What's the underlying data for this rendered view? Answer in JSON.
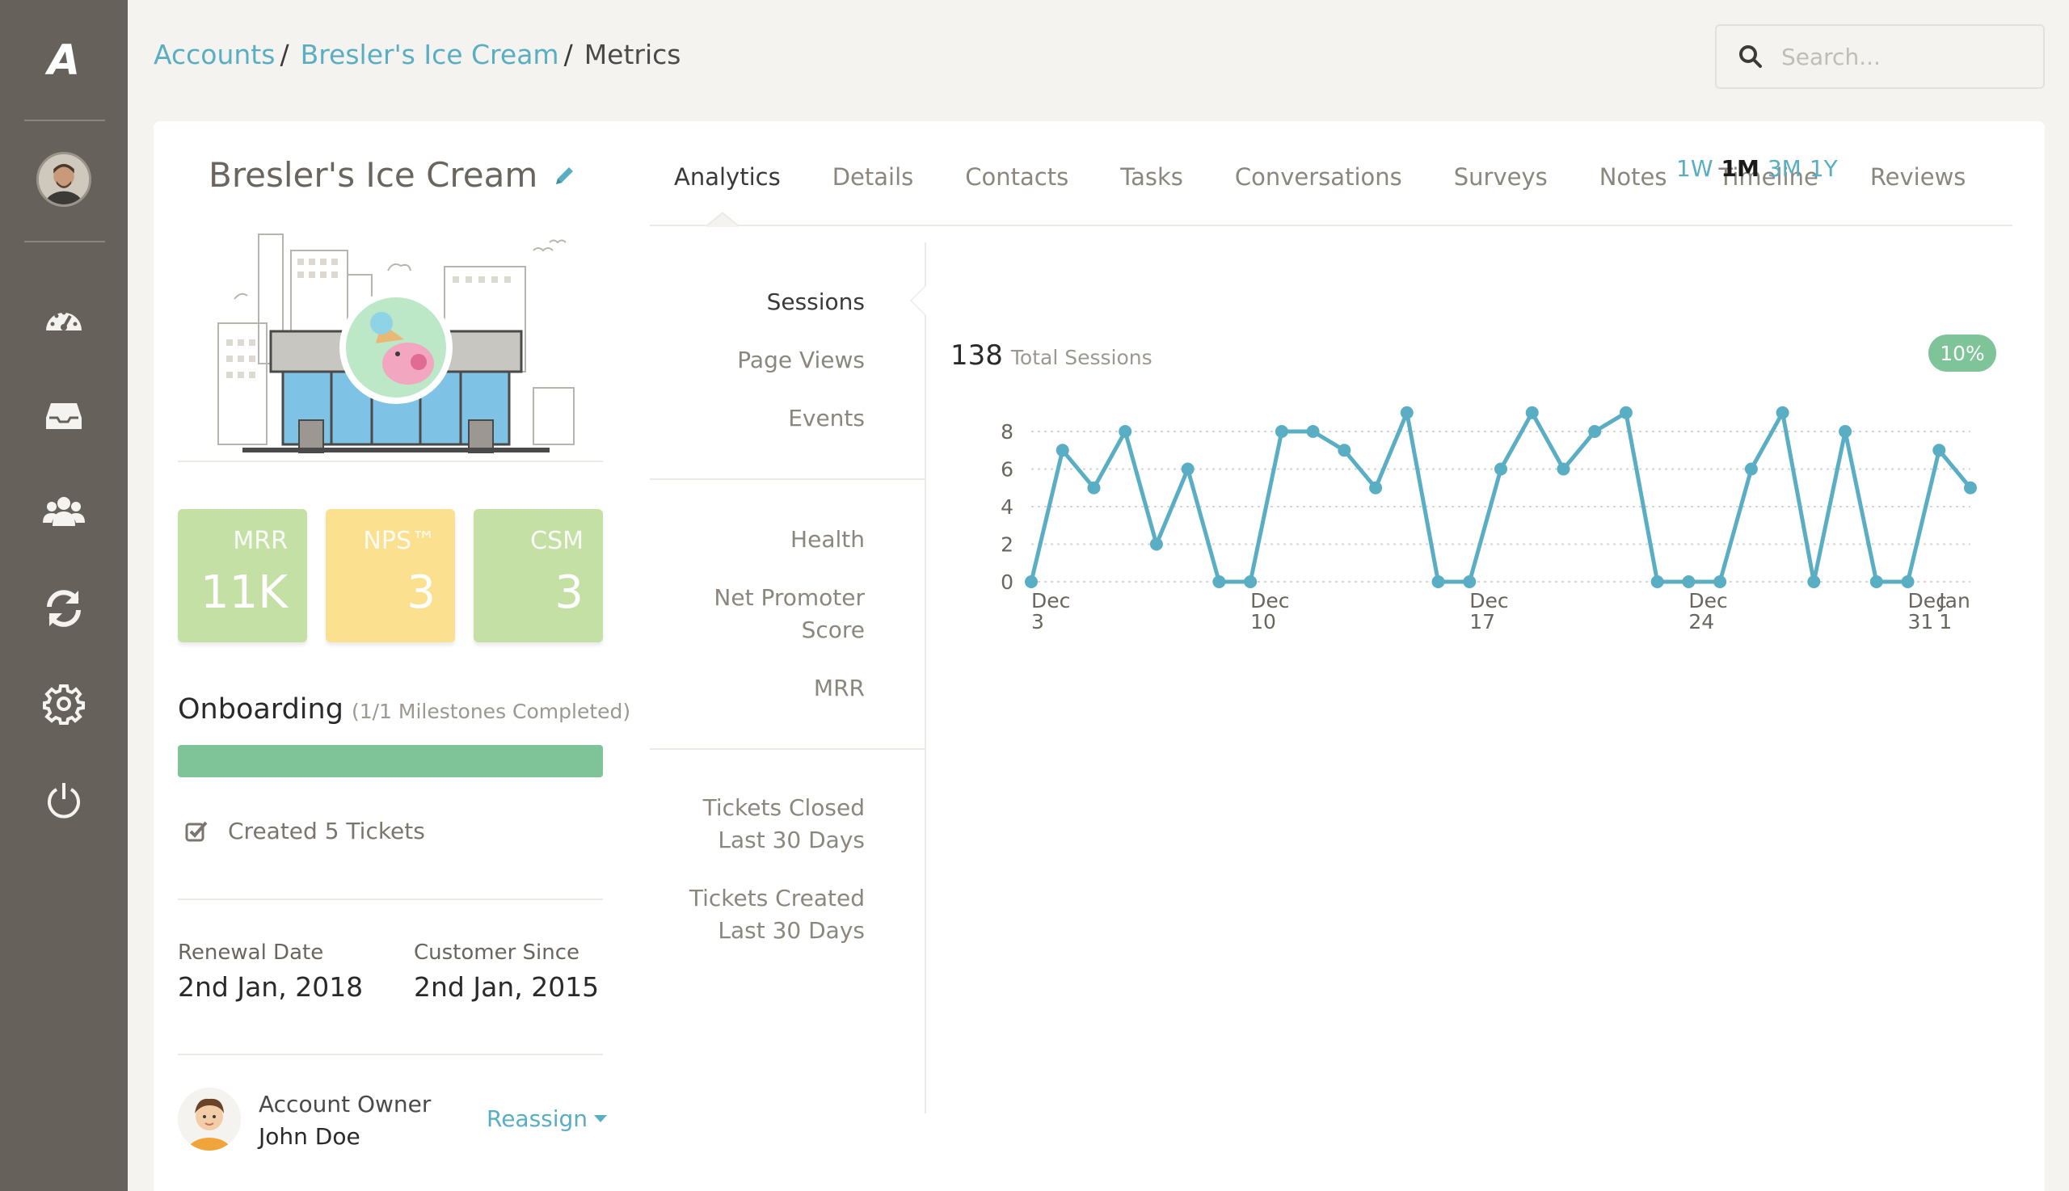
{
  "sidebar": {
    "logo": "A",
    "icons": [
      "dashboard-icon",
      "inbox-icon",
      "users-icon",
      "refresh-icon",
      "gear-icon",
      "power-icon"
    ]
  },
  "breadcrumb": {
    "items": [
      "Accounts",
      "Bresler's Ice Cream"
    ],
    "current": "Metrics"
  },
  "search": {
    "placeholder": "Search..."
  },
  "account": {
    "name": "Bresler's Ice Cream",
    "stats": [
      {
        "label": "MRR",
        "value": "11K",
        "color": "#c5e0a5"
      },
      {
        "label": "NPS™",
        "value": "3",
        "color": "#fbe08f"
      },
      {
        "label": "CSM",
        "value": "3",
        "color": "#c5e0a5"
      }
    ],
    "onboarding": {
      "title": "Onboarding",
      "subtitle": "(1/1 Milestones Completed)",
      "progress_fraction": 1.0,
      "task": "Created 5 Tickets"
    },
    "renewal": {
      "label": "Renewal Date",
      "value": "2nd Jan, 2018"
    },
    "customer_since": {
      "label": "Customer Since",
      "value": "2nd Jan, 2015"
    },
    "owner": {
      "label": "Account Owner",
      "name": "John Doe",
      "reassign": "Reassign"
    }
  },
  "tabs": [
    {
      "label": "Analytics",
      "active": true
    },
    {
      "label": "Details"
    },
    {
      "label": "Contacts"
    },
    {
      "label": "Tasks"
    },
    {
      "label": "Conversations"
    },
    {
      "label": "Surveys"
    },
    {
      "label": "Notes"
    },
    {
      "label": "Timeline"
    },
    {
      "label": "Reviews"
    }
  ],
  "metrics_menu": {
    "sessions": "Sessions",
    "page_views": "Page Views",
    "events": "Events",
    "health": "Health",
    "nps_line1": "Net Promoter",
    "nps_line2": "Score",
    "mrr": "MRR",
    "closed_line1": "Tickets Closed",
    "closed_line2": "Last 30 Days",
    "created_line1": "Tickets Created",
    "created_line2": "Last 30 Days"
  },
  "ranges": [
    {
      "label": "1W"
    },
    {
      "label": "1M",
      "active": true
    },
    {
      "label": "3M"
    },
    {
      "label": "1Y"
    }
  ],
  "total": {
    "value": "138",
    "label": "Total Sessions",
    "badge": "10%"
  },
  "chart_data": {
    "type": "line",
    "title": "",
    "xlabel": "",
    "ylabel": "",
    "ylim": [
      0,
      8
    ],
    "yticks": [
      0,
      2,
      4,
      6,
      8
    ],
    "grid": true,
    "color": "#5aaec4",
    "x_tick_labels": [
      {
        "index": 0,
        "line1": "Dec",
        "line2": "3"
      },
      {
        "index": 7,
        "line1": "Dec",
        "line2": "10"
      },
      {
        "index": 14,
        "line1": "Dec",
        "line2": "17"
      },
      {
        "index": 21,
        "line1": "Dec",
        "line2": "24"
      },
      {
        "index": 28,
        "line1": "Dec",
        "line2": "31"
      },
      {
        "index": 29,
        "line1": "Jan",
        "line2": "1"
      }
    ],
    "series": [
      {
        "values": [
          0,
          7,
          5,
          8,
          2,
          6,
          0,
          0,
          8,
          8,
          7,
          5,
          9,
          0,
          0,
          6,
          9,
          6,
          8,
          9,
          0,
          0,
          0,
          6,
          9,
          0,
          8,
          0,
          0,
          7,
          5
        ]
      }
    ]
  }
}
